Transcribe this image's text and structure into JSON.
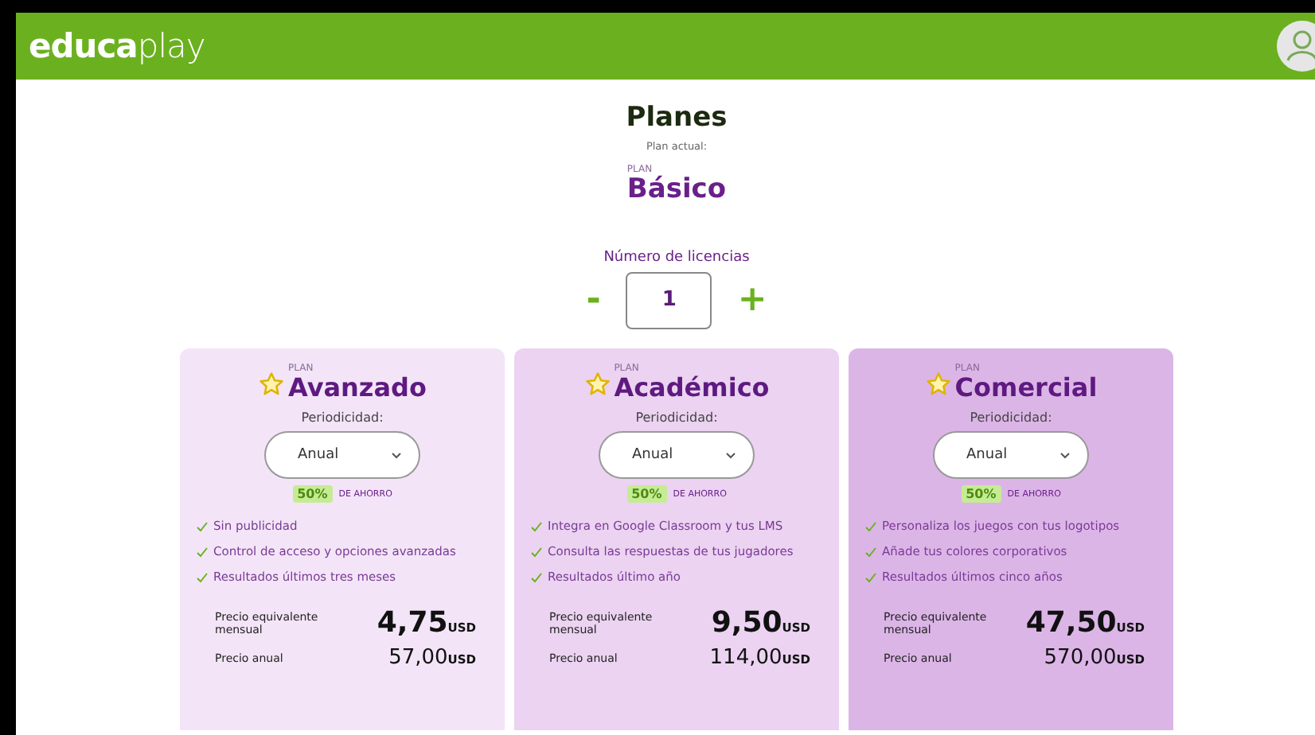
{
  "header": {
    "logo": "**educa**play"
  },
  "title": "Planes",
  "current_plan": {
    "label": "Plan actual:",
    "prefix": "PLAN",
    "name": "Básico"
  },
  "licenses": {
    "label": "Número de licencias",
    "decrement": "-",
    "value": "1",
    "increment": "+"
  },
  "plans": [
    {
      "prefix": "PLAN",
      "name": "Avanzado",
      "color": "#f3e5f7",
      "period_label": "Periodicidad:",
      "period": "Anual",
      "discount": "50%",
      "discount_label": "DE AHORRO",
      "features": [
        "Sin publicidad",
        "Control de acceso y opciones avanzadas",
        "Resultados últimos tres meses"
      ],
      "monthly_label": "Precio equivalente mensual",
      "monthly_price": "4,75",
      "monthly_currency": "USD",
      "annual_label": "Precio anual",
      "annual_price": "57,00",
      "annual_currency": "USD"
    },
    {
      "prefix": "PLAN",
      "name": "Académico",
      "color": "#ebd3f1",
      "period_label": "Periodicidad:",
      "period": "Anual",
      "discount": "50%",
      "discount_label": "DE AHORRO",
      "features": [
        "Integra en Google Classroom y tus LMS",
        "Consulta las respuestas de tus jugadores",
        "Resultados último año"
      ],
      "monthly_label": "Precio equivalente mensual",
      "monthly_price": "9,50",
      "monthly_currency": "USD",
      "annual_label": "Precio anual",
      "annual_price": "114,00",
      "annual_currency": "USD"
    },
    {
      "prefix": "PLAN",
      "name": "Comercial",
      "color": "#dcb5e7",
      "period_label": "Periodicidad:",
      "period": "Anual",
      "discount": "50%",
      "discount_label": "DE AHORRO",
      "features": [
        "Personaliza los juegos con tus logotipos",
        "Añade tus colores corporativos",
        "Resultados últimos cinco años"
      ],
      "monthly_label": "Precio equivalente mensual",
      "monthly_price": "47,50",
      "monthly_currency": "USD",
      "annual_label": "Precio anual",
      "annual_price": "570,00",
      "annual_currency": "USD"
    }
  ]
}
